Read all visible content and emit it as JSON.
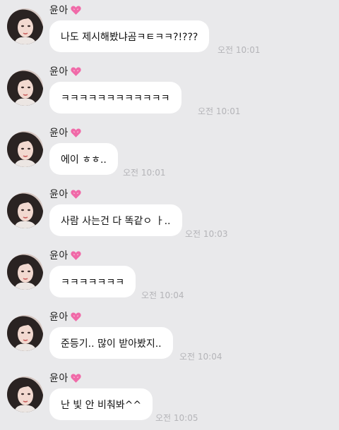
{
  "chat": {
    "messages": [
      {
        "sender": "윤아",
        "sender_emoji": "heart-icon",
        "avatar": "profile-photo",
        "text": "나도 제시해봤냐곰ㅋㅌㅋㅋ?!???",
        "time": "오전 10:01"
      },
      {
        "sender": "윤아",
        "sender_emoji": "heart-icon",
        "avatar": "profile-photo",
        "text": "ㅋㅋㅋㅋㅋㅋㅋㅋㅋㅋㅋㅋ",
        "time": "오전 10:01"
      },
      {
        "sender": "윤아",
        "sender_emoji": "heart-icon",
        "avatar": "profile-photo",
        "text": "에이 ㅎㅎ..",
        "time": "오전 10:01"
      },
      {
        "sender": "윤아",
        "sender_emoji": "heart-icon",
        "avatar": "profile-photo",
        "text": "사람 사는건 다 똑같ㅇ ㅏ..",
        "time": "오전 10:03"
      },
      {
        "sender": "윤아",
        "sender_emoji": "heart-icon",
        "avatar": "profile-photo",
        "text": "ㅋㅋㅋㅋㅋㅋㅋ",
        "time": "오전 10:04"
      },
      {
        "sender": "윤아",
        "sender_emoji": "heart-icon",
        "avatar": "profile-photo",
        "text": "준등기.. 많이 받아봤지..",
        "time": "오전 10:04"
      },
      {
        "sender": "윤아",
        "sender_emoji": "heart-icon",
        "avatar": "profile-photo",
        "text": "난 빛 안 비춰봐^^",
        "time": "오전 10:05"
      }
    ]
  },
  "colors": {
    "background": "#e9e9eb",
    "bubble": "#ffffff",
    "timestamp": "#b4b4b8",
    "heart": "#f06aa8"
  }
}
